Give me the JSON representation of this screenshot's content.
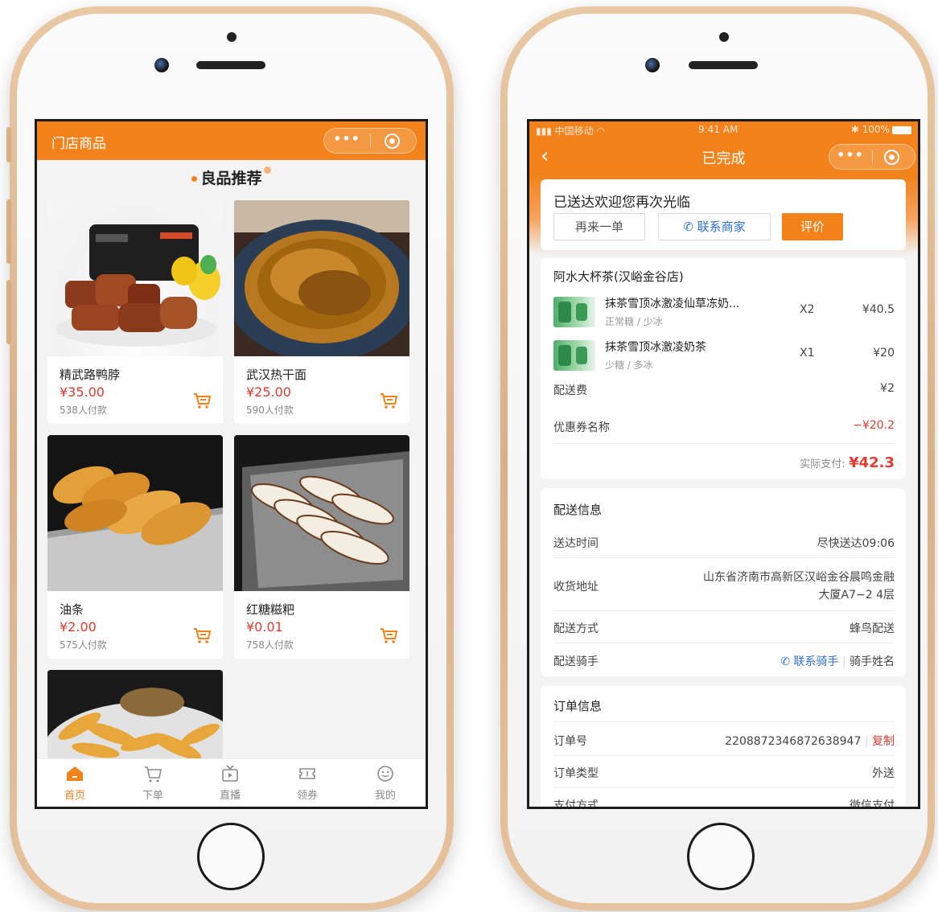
{
  "left_phone": {
    "header": {
      "title": "门店商品"
    },
    "section_title": "良品推荐",
    "products": [
      {
        "name": "精武路鸭脖",
        "price": "¥35.00",
        "paid": "538人付款"
      },
      {
        "name": "武汉热干面",
        "price": "¥25.00",
        "paid": "590人付款"
      },
      {
        "name": "油条",
        "price": "¥2.00",
        "paid": "575人付款"
      },
      {
        "name": "红糖糍粑",
        "price": "¥0.01",
        "paid": "758人付款"
      }
    ],
    "tabbar": [
      {
        "label": "首页",
        "icon": "home-icon",
        "active": true
      },
      {
        "label": "下单",
        "icon": "cart-icon"
      },
      {
        "label": "直播",
        "icon": "live-tv-icon"
      },
      {
        "label": "领券",
        "icon": "coupon-icon"
      },
      {
        "label": "我的",
        "icon": "profile-icon"
      }
    ]
  },
  "right_phone": {
    "status_bar": {
      "carrier": "中国移动",
      "time": "9:41 AM",
      "battery": "100%"
    },
    "header": {
      "title": "已完成"
    },
    "delivered": {
      "title": "已送达欢迎您再次光临",
      "reorder": "再来一单",
      "contact_merchant": "联系商家",
      "review": "评价"
    },
    "order": {
      "shop": "阿水大杯茶(汉峪金谷店)",
      "items": [
        {
          "name": "抹茶雪顶冰激凌仙草冻奶...",
          "spec": "正常糖 / 少冰",
          "qty": "X2",
          "price": "¥40.5"
        },
        {
          "name": "抹茶雪顶冰激凌奶茶",
          "spec": "少糖 / 多冰",
          "qty": "X1",
          "price": "¥20"
        }
      ],
      "delivery_fee_label": "配送费",
      "delivery_fee": "¥2",
      "coupon_label": "优惠券名称",
      "coupon_value": "−¥20.2",
      "actual_label": "实际支付:",
      "actual_value": "¥42.3"
    },
    "delivery_info": {
      "title": "配送信息",
      "time_label": "送达时间",
      "time_value": "尽快送达09:06",
      "address_label": "收货地址",
      "address_line1": "山东省济南市高新区汉峪金谷晨鸣金融",
      "address_line2": "大厦A7−2 4层",
      "method_label": "配送方式",
      "method_value": "蜂鸟配送",
      "rider_label": "配送骑手",
      "contact_rider": "联系骑手",
      "rider_name": "骑手姓名"
    },
    "order_info": {
      "title": "订单信息",
      "no_label": "订单号",
      "no_value": "2208872346872638947",
      "copy": "复制",
      "type_label": "订单类型",
      "type_value": "外送",
      "pay_label": "支付方式",
      "pay_value": "微信支付"
    }
  },
  "colors": {
    "accent": "#f28219",
    "price": "#e23b30",
    "link": "#2f6fd6"
  }
}
